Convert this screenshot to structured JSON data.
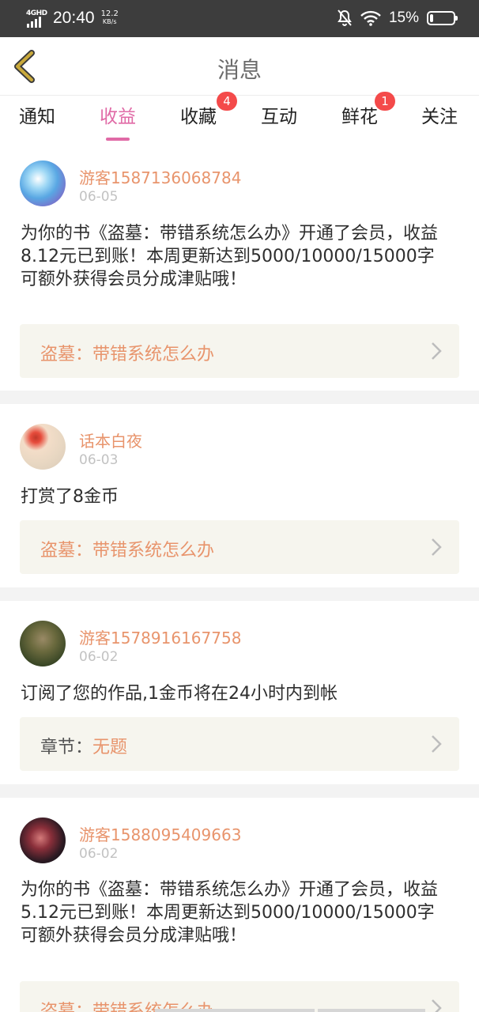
{
  "status_bar": {
    "network": "4GHD",
    "time": "20:40",
    "speed_value": "12.2",
    "speed_unit": "KB/s",
    "battery_percent": "15%",
    "battery_level": 0.15
  },
  "header": {
    "title": "消息",
    "back_icon": "chevron-left-icon"
  },
  "tabs": [
    {
      "label": "通知",
      "active": false,
      "badge": ""
    },
    {
      "label": "收益",
      "active": true,
      "badge": ""
    },
    {
      "label": "收藏",
      "active": false,
      "badge": "4"
    },
    {
      "label": "互动",
      "active": false,
      "badge": ""
    },
    {
      "label": "鲜花",
      "active": false,
      "badge": "1"
    },
    {
      "label": "关注",
      "active": false,
      "badge": ""
    }
  ],
  "messages": [
    {
      "username": "游客1587136068784",
      "date": "06-05",
      "text": "为你的书《盗墓：带错系统怎么办》开通了会员，收益8.12元已到账！本周更新达到5000/10000/15000字可额外获得会员分成津贴哦！",
      "link_prefix": "",
      "link_text": "盗墓：带错系统怎么办"
    },
    {
      "username": "话本白夜",
      "date": "06-03",
      "text": "打赏了8金币",
      "link_prefix": "",
      "link_text": "盗墓：带错系统怎么办"
    },
    {
      "username": "游客1578916167758",
      "date": "06-02",
      "text": "订阅了您的作品,1金币将在24小时内到帐",
      "link_prefix": "章节：",
      "link_text": "无题"
    },
    {
      "username": "游客1588095409663",
      "date": "06-02",
      "text": "为你的书《盗墓：带错系统怎么办》开通了会员，收益5.12元已到账！本周更新达到5000/10000/15000字可额外获得会员分成津贴哦！",
      "link_prefix": "",
      "link_text": "盗墓：带错系统怎么办"
    }
  ],
  "colors": {
    "accent": "#e06aa6",
    "username": "#e8946c",
    "badge": "#f44a4a",
    "back_arrow": "#c9a93b"
  }
}
